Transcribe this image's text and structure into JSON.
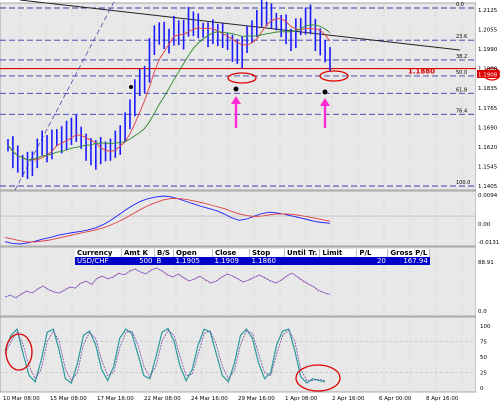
{
  "colors": {
    "background": "#e8e8e8",
    "grid": "#b4b4b4",
    "candles": "#1a1aff",
    "ma_fast": "#e04040",
    "ma_slow": "#2a8a2a",
    "trendline": "#222222",
    "fib": "#3b3baa",
    "stop_line": "#dd0000",
    "annotation": "#ff2ad4",
    "circle": "#dd0000",
    "table_row": "#0000c8"
  },
  "price_axis": {
    "ticks": [
      "1.2125",
      "1.2055",
      "1.1990",
      "1.1908",
      "1.1835",
      "1.1765",
      "1.1690",
      "1.1620",
      "1.1545",
      "1.1405"
    ],
    "current_price_label": "1.1908"
  },
  "fib_labels": [
    "0.0",
    "23.6",
    "38.2",
    "50.0",
    "61.8",
    "76.4",
    "100.0"
  ],
  "stop_label": "1.1880",
  "trade_panel": {
    "headers": [
      "Currency",
      "Amt K",
      "B/S",
      "Open",
      "Close",
      "Stop",
      "Until Tr.",
      "Limit",
      "P/L",
      "Gross P/L"
    ],
    "row": {
      "currency": "USD/CHF",
      "amt_k": "500",
      "bs": "B",
      "open": "1.1905",
      "close": "1.1909",
      "stop": "1.1860",
      "until_tr": "",
      "limit": "",
      "pl": "20",
      "gross_pl": "167.94"
    }
  },
  "macd_axis": {
    "ticks": [
      "0.0094",
      "0.00",
      "-0.0131"
    ]
  },
  "rsi_axis": {
    "ticks": [
      "88.91",
      "0.0"
    ]
  },
  "stoch_axis": {
    "ticks": [
      "100",
      "75",
      "50",
      "25",
      "0"
    ]
  },
  "time_axis": {
    "labels": [
      "10 Mar 08:00",
      "15 Mar 08:00",
      "17 Mar 16:00",
      "22 Mar 08:00",
      "24 Mar 16:00",
      "29 Mar 16:00",
      "1 Apr 08:00",
      "2 Apr 16:00",
      "6 Apr 00:00",
      "8 Apr 16:00"
    ]
  },
  "chart_data": {
    "type": "candlestick",
    "symbol": "USD/CHF",
    "ylim": [
      1.1405,
      1.2125
    ],
    "fib_levels": [
      {
        "label": "0.0",
        "price": 1.2125
      },
      {
        "label": "23.6",
        "price": 1.1995
      },
      {
        "label": "38.2",
        "price": 1.1915
      },
      {
        "label": "50.0",
        "price": 1.185
      },
      {
        "label": "61.8",
        "price": 1.178
      },
      {
        "label": "76.4",
        "price": 1.1695
      },
      {
        "label": "100.0",
        "price": 1.1405
      }
    ],
    "stop_level": 1.188,
    "closes": [
      1.157,
      1.152,
      1.149,
      1.15,
      1.147,
      1.152,
      1.156,
      1.158,
      1.155,
      1.159,
      1.161,
      1.158,
      1.162,
      1.165,
      1.162,
      1.158,
      1.155,
      1.152,
      1.156,
      1.153,
      1.156,
      1.155,
      1.158,
      1.162,
      1.166,
      1.173,
      1.18,
      1.183,
      1.186,
      1.196,
      1.203,
      1.202,
      1.199,
      1.201,
      1.205,
      1.2,
      1.204,
      1.208,
      1.206,
      1.204,
      1.203,
      1.201,
      1.203,
      1.202,
      1.2,
      1.198,
      1.195,
      1.193,
      1.198,
      1.201,
      1.205,
      1.208,
      1.212,
      1.21,
      1.208,
      1.206,
      1.205,
      1.201,
      1.2,
      1.204,
      1.206,
      1.209,
      1.205,
      1.2,
      1.197,
      1.193,
      1.191
    ],
    "macd": [
      -0.012,
      -0.0128,
      -0.0131,
      -0.0126,
      -0.0118,
      -0.0108,
      -0.01,
      -0.009,
      -0.0083,
      -0.0077,
      -0.0072,
      -0.0065,
      -0.0055,
      -0.004,
      -0.002,
      0.0005,
      0.003,
      0.0052,
      0.007,
      0.0082,
      0.009,
      0.0094,
      0.009,
      0.008,
      0.0068,
      0.0056,
      0.0045,
      0.0035,
      0.0025,
      0.001,
      -0.0008,
      -0.002,
      -0.0014,
      0.0,
      0.0012,
      0.0018,
      0.0015,
      0.0008,
      0.0,
      -0.0008,
      -0.0016,
      -0.0025,
      -0.003,
      -0.0034
    ],
    "macd_signal": [
      -0.01,
      -0.0108,
      -0.0116,
      -0.0121,
      -0.0121,
      -0.0117,
      -0.0112,
      -0.0104,
      -0.0096,
      -0.0088,
      -0.008,
      -0.0073,
      -0.0065,
      -0.0055,
      -0.0042,
      -0.0026,
      -0.0008,
      0.0012,
      0.0032,
      0.005,
      0.0064,
      0.0076,
      0.0082,
      0.0082,
      0.0078,
      0.0071,
      0.0063,
      0.0054,
      0.0045,
      0.0035,
      0.0022,
      0.001,
      0.0002,
      -0.0002,
      0.0,
      0.0006,
      0.001,
      0.001,
      0.0008,
      0.0003,
      -0.0003,
      -0.001,
      -0.0017,
      -0.0024
    ],
    "rsi": [
      30,
      34,
      28,
      36,
      42,
      38,
      46,
      52,
      45,
      40,
      38,
      44,
      50,
      48,
      58,
      62,
      55,
      68,
      72,
      66,
      70,
      78,
      74,
      82,
      86,
      80,
      76,
      84,
      88,
      82,
      74,
      70,
      76,
      68,
      62,
      66,
      72,
      64,
      58,
      62,
      70,
      76,
      72,
      66,
      60,
      64,
      70,
      74,
      68,
      62,
      58,
      64,
      72,
      78,
      70,
      62,
      56,
      50,
      42,
      38,
      35
    ],
    "stoch": [
      60,
      85,
      95,
      55,
      20,
      10,
      45,
      90,
      95,
      60,
      15,
      8,
      40,
      85,
      92,
      70,
      30,
      12,
      35,
      80,
      95,
      88,
      55,
      20,
      15,
      50,
      90,
      96,
      75,
      35,
      12,
      30,
      70,
      95,
      90,
      55,
      20,
      10,
      40,
      85,
      95,
      80,
      40,
      15,
      25,
      70,
      92,
      95,
      60,
      18,
      8,
      15,
      12,
      10
    ],
    "stoch_signal": [
      55,
      75,
      90,
      70,
      35,
      15,
      30,
      75,
      92,
      75,
      30,
      12,
      25,
      70,
      90,
      80,
      45,
      20,
      25,
      65,
      90,
      92,
      70,
      35,
      18,
      35,
      75,
      93,
      85,
      50,
      20,
      22,
      55,
      88,
      92,
      70,
      35,
      15,
      28,
      70,
      92,
      88,
      55,
      25,
      20,
      55,
      85,
      94,
      75,
      30,
      12,
      12,
      14,
      12
    ]
  }
}
